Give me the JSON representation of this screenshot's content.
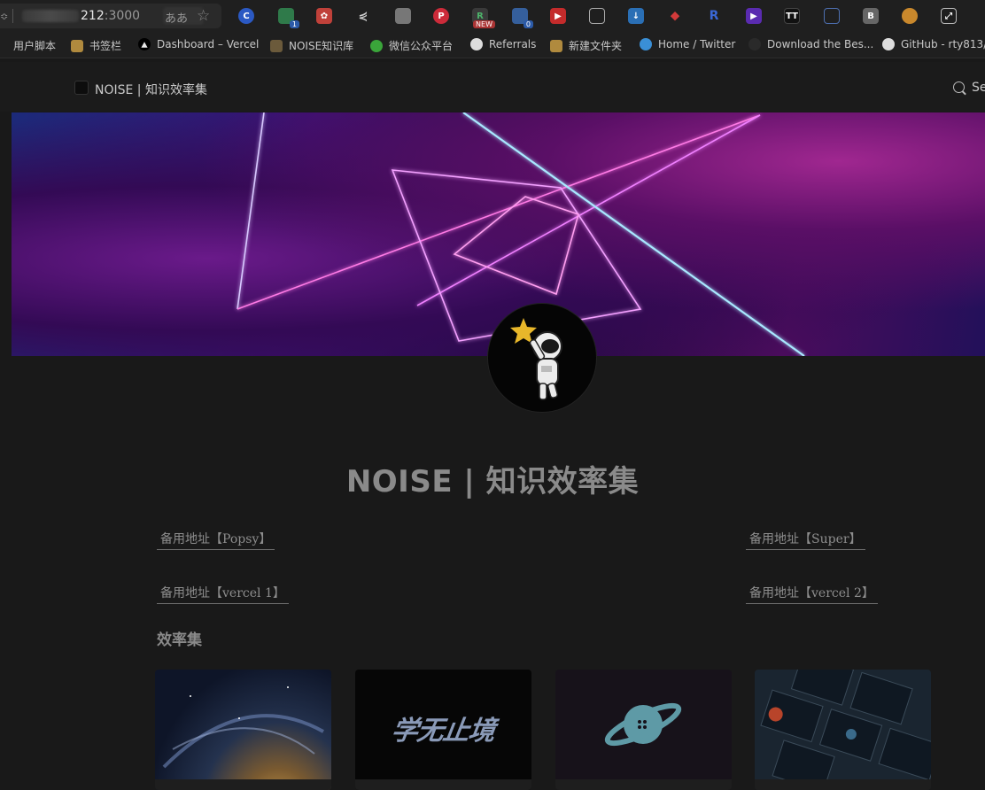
{
  "browser": {
    "address": {
      "port_bold": "212",
      "port_rest": ":3000"
    },
    "bookmarks": [
      {
        "label": "用户脚本"
      },
      {
        "label": "书签栏"
      },
      {
        "label": "Dashboard – Vercel"
      },
      {
        "label": "NOISE知识库"
      },
      {
        "label": "微信公众平台"
      },
      {
        "label": "Referrals"
      },
      {
        "label": "新建文件夹"
      },
      {
        "label": "Home / Twitter"
      },
      {
        "label": "Download the Bes..."
      },
      {
        "label": "GitHub - rty813/..."
      }
    ],
    "extensions": [
      {
        "name": "translate-icon",
        "text": "ああ"
      },
      {
        "name": "ext-badge-1",
        "badge": "1"
      },
      {
        "name": "ext-new",
        "badge": "NEW"
      },
      {
        "name": "ext-badge-0",
        "badge": "0"
      },
      {
        "name": "ext-tt",
        "text": "TT"
      },
      {
        "name": "ext-b",
        "text": "B"
      }
    ]
  },
  "page": {
    "site_title": "NOISE | 知识效率集",
    "search_label": "Se",
    "title": "NOISE | 知识效率集",
    "alt_links": [
      {
        "label": "备用地址【Popsy】"
      },
      {
        "label": "备用地址【Super】"
      },
      {
        "label": "备用地址【vercel 1】"
      },
      {
        "label": "备用地址【vercel 2】"
      }
    ],
    "section_title": "效率集",
    "cards": [
      {
        "name": "card-galaxy"
      },
      {
        "name": "card-learning",
        "text": "学无止境"
      },
      {
        "name": "card-planet"
      },
      {
        "name": "card-design"
      }
    ]
  }
}
